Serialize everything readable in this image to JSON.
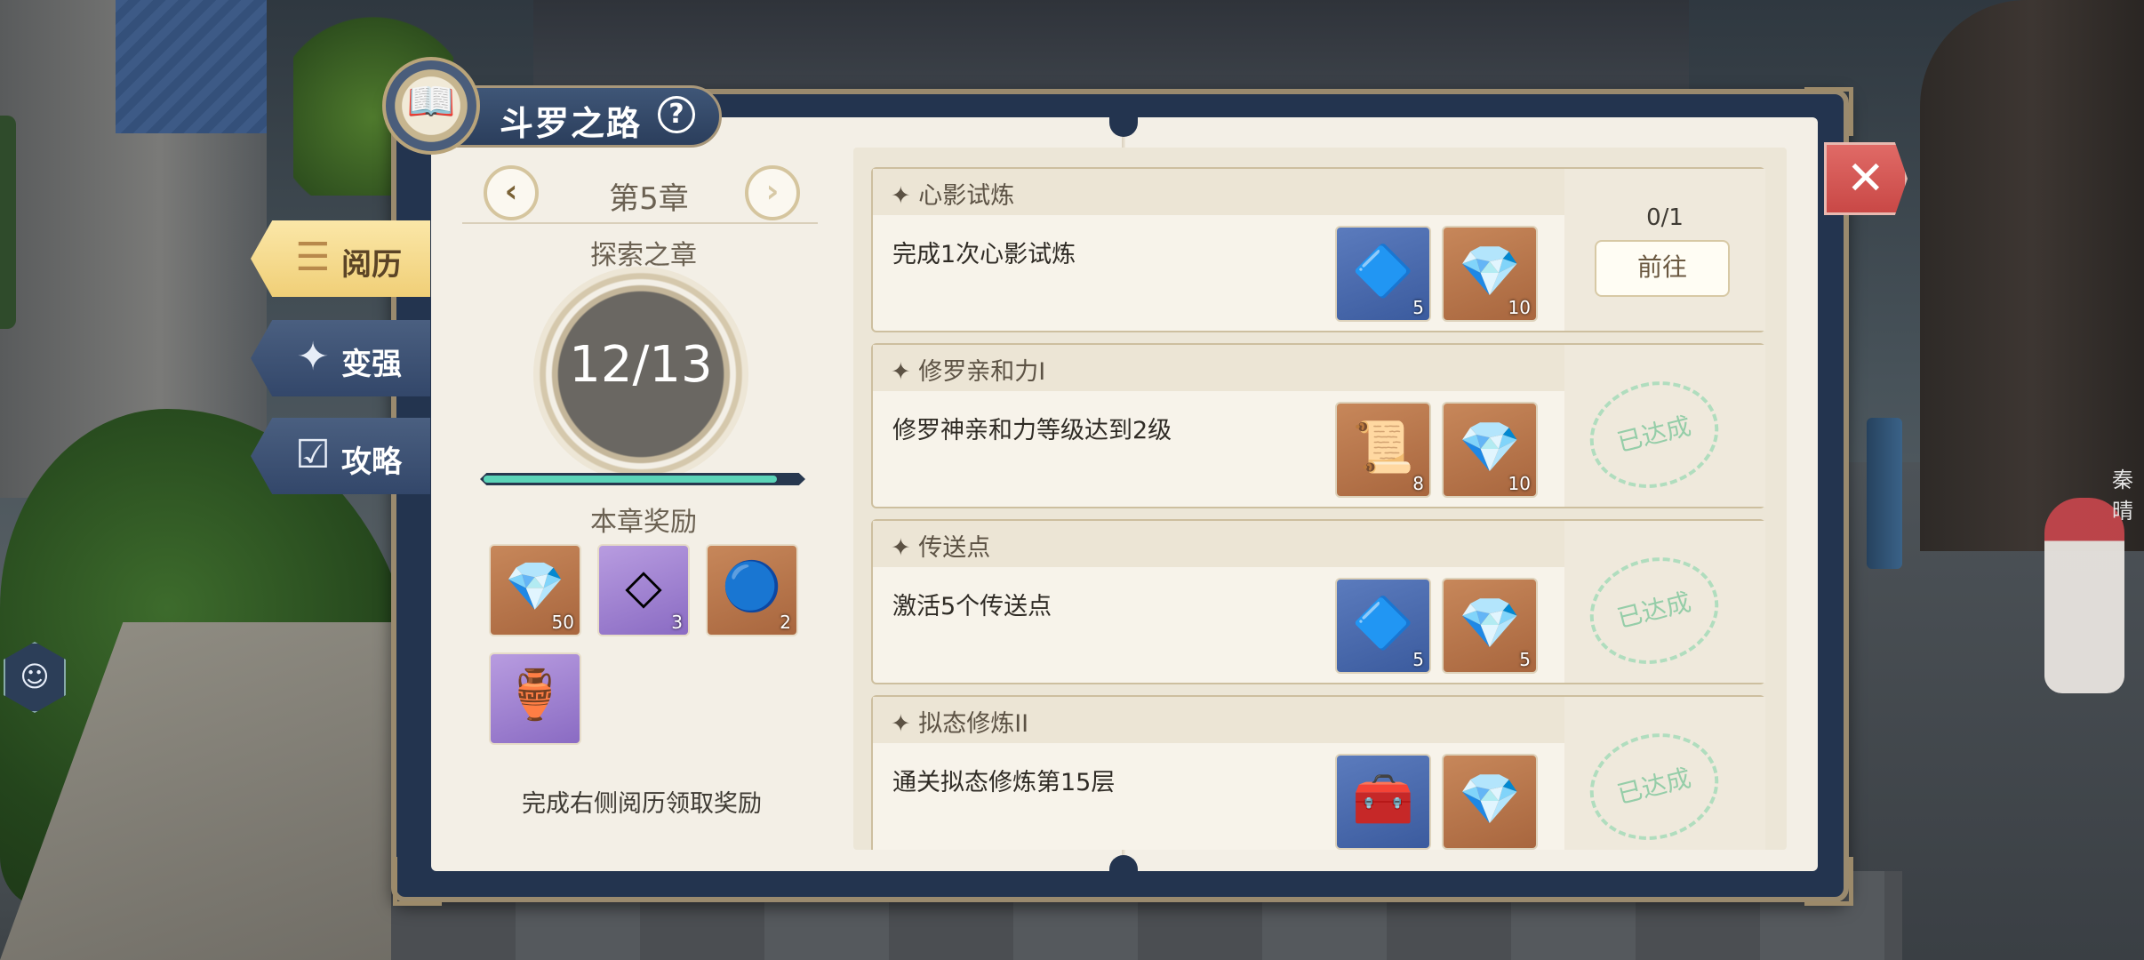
{
  "header": {
    "title": "斗罗之路",
    "help_icon": "question-icon"
  },
  "side_tabs": [
    {
      "label": "阅历",
      "icon": "scroll-icon",
      "active": true
    },
    {
      "label": "变强",
      "icon": "star-up-icon",
      "active": false
    },
    {
      "label": "攻略",
      "icon": "checklist-icon",
      "active": false
    }
  ],
  "chapter": {
    "title": "第5章",
    "prev_glyph": "‹",
    "next_glyph": "›",
    "explore_title": "探索之章",
    "progress_text": "12/13",
    "progress_fraction": 0.923
  },
  "chapter_rewards": {
    "title": "本章奖励",
    "hint": "完成右侧阅历领取奖励",
    "items": [
      {
        "icon": "blue-crystal-icon",
        "count": "50"
      },
      {
        "icon": "white-crystal-icon",
        "count": "3"
      },
      {
        "icon": "blue-orb-icon",
        "count": "2"
      },
      {
        "icon": "golden-relic-icon",
        "count": ""
      }
    ]
  },
  "tasks": [
    {
      "title": "心影试炼",
      "desc": "完成1次心影试炼",
      "items": [
        {
          "icon": "crescent-crystal-icon",
          "count": "5"
        },
        {
          "icon": "blue-crystal-icon",
          "count": "10"
        }
      ],
      "progress": "0/1",
      "action": "前往",
      "done_stamp": ""
    },
    {
      "title": "修罗亲和力I",
      "desc": "修罗神亲和力等级达到2级",
      "items": [
        {
          "icon": "parchment-icon",
          "count": "8"
        },
        {
          "icon": "blue-crystal-icon",
          "count": "10"
        }
      ],
      "progress": "",
      "action": "",
      "done_stamp": "已达成"
    },
    {
      "title": "传送点",
      "desc": "激活5个传送点",
      "items": [
        {
          "icon": "crescent-crystal-icon",
          "count": "5"
        },
        {
          "icon": "blue-crystal-icon",
          "count": "5"
        }
      ],
      "progress": "",
      "action": "",
      "done_stamp": "已达成"
    },
    {
      "title": "拟态修炼II",
      "desc": "通关拟态修炼第15层",
      "items": [
        {
          "icon": "treasure-chest-icon",
          "count": ""
        },
        {
          "icon": "blue-crystal-icon",
          "count": ""
        }
      ],
      "progress": "",
      "action": "",
      "done_stamp": "已达成"
    }
  ],
  "scene": {
    "npc_name": "秦晴"
  },
  "colors": {
    "accent_gold": "#f0cf77",
    "frame_navy": "#23344f",
    "progress_teal": "#5bd4b8",
    "close_red": "#d05753",
    "stamp_green": "#86c9a0"
  }
}
